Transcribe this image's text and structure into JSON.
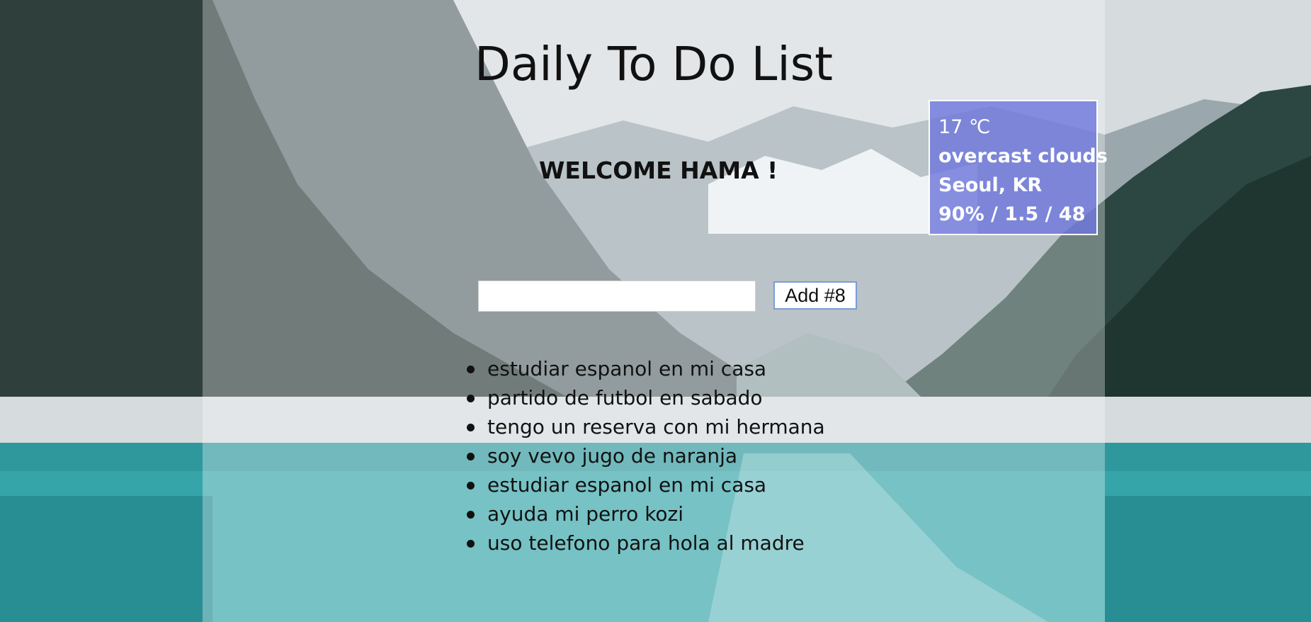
{
  "app": {
    "title": "Daily To Do List",
    "welcome": "WELCOME HAMA !"
  },
  "weather": {
    "temperature": "17 ℃",
    "description": "overcast clouds",
    "location": "Seoul, KR",
    "stats": "90% / 1.5 / 48",
    "panel_color": "#6e78dc"
  },
  "form": {
    "input_value": "",
    "add_button_label": "Add #8"
  },
  "todos": [
    "estudiar espanol en mi casa",
    "partido de futbol en sabado",
    "tengo un reserva con mi hermana",
    "soy vevo jugo de naranja",
    "estudiar espanol en mi casa",
    "ayuda mi perro kozi",
    "uso telefono para hola al madre"
  ],
  "background": {
    "image": "mountain-lake-photo"
  }
}
